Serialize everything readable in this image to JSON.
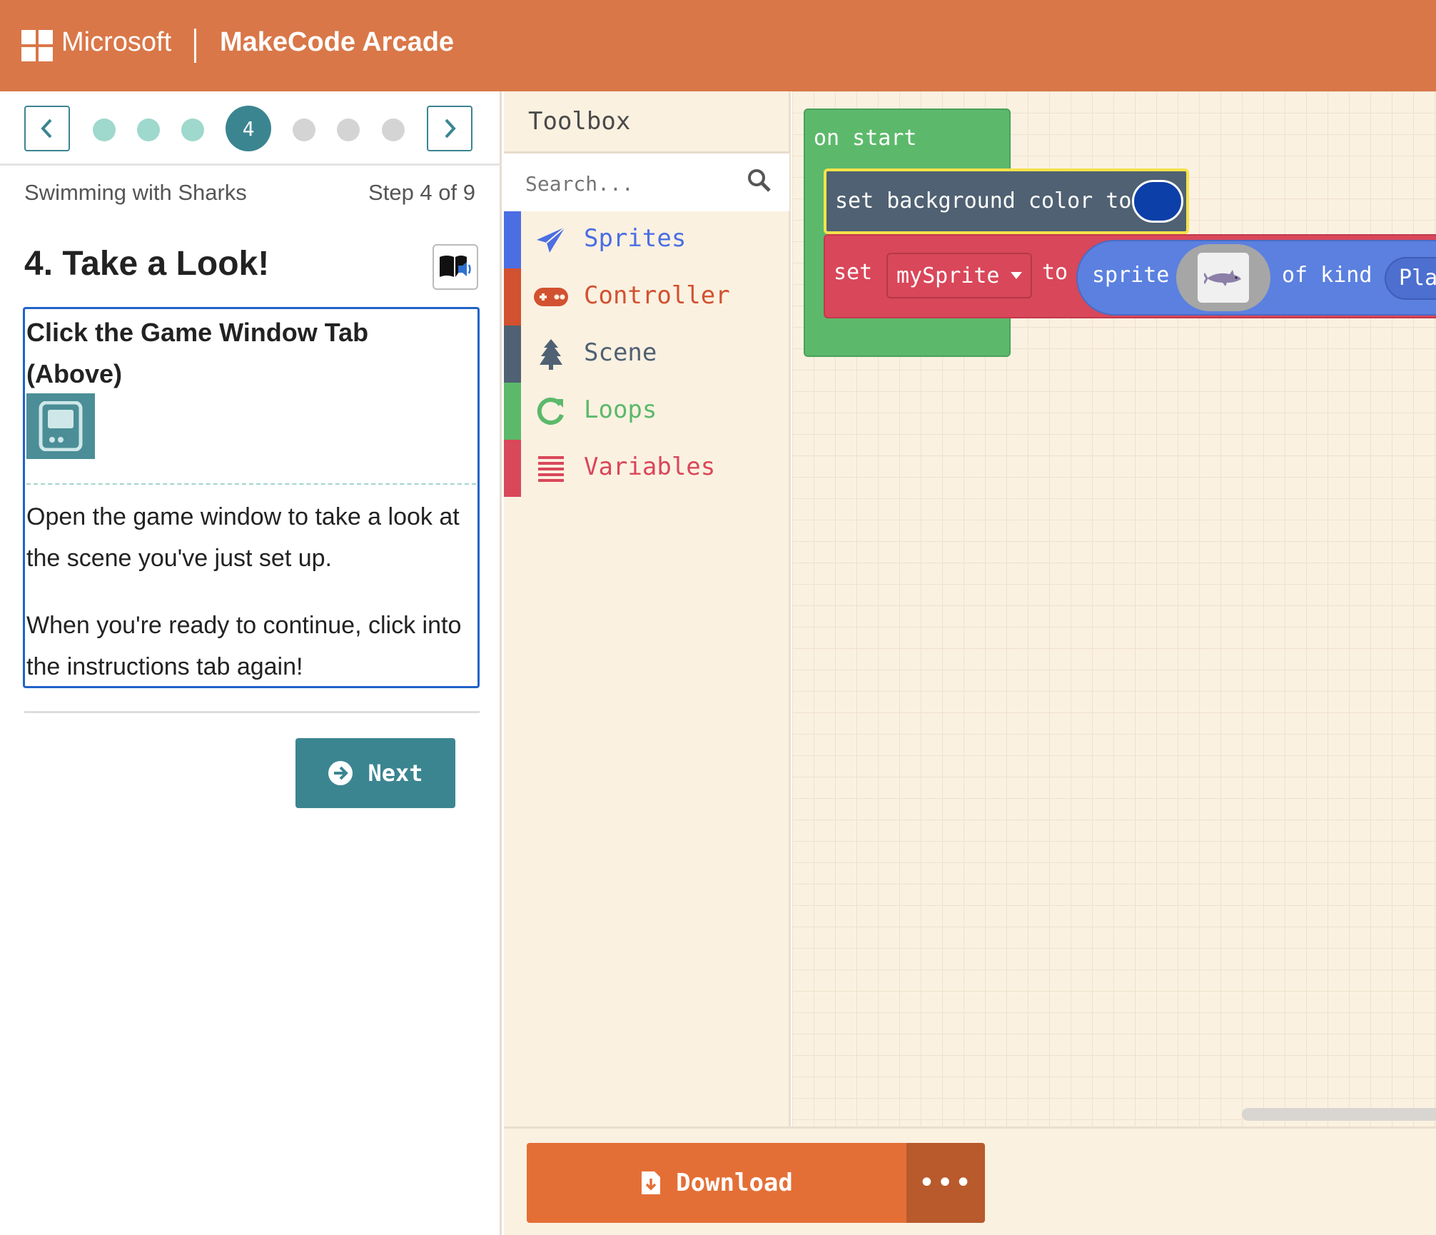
{
  "header": {
    "brand": "Microsoft",
    "app_title": "MakeCode Arcade",
    "bg_color": "#d97748"
  },
  "tutorial": {
    "current_step_number": "4",
    "steps_total": 9,
    "current_step": 4,
    "name": "Swimming with Sharks",
    "step_label": "Step 4 of 9",
    "title": "4. Take a Look!",
    "instruction_heading": "Click the Game Window Tab (Above)",
    "paragraph1": "Open the game window to take a look at the scene you've just set up.",
    "paragraph2": "When you're ready to continue, click into the instructions tab again!",
    "next_label": "Next",
    "accent_color": "#3b8591"
  },
  "toolbox": {
    "title": "Toolbox",
    "search_placeholder": "Search...",
    "categories": [
      {
        "label": "Sprites",
        "icon": "paper-plane-icon",
        "color": "#4b6ee3"
      },
      {
        "label": "Controller",
        "icon": "gamepad-icon",
        "color": "#d25130"
      },
      {
        "label": "Scene",
        "icon": "tree-icon",
        "color": "#4f6172"
      },
      {
        "label": "Loops",
        "icon": "refresh-icon",
        "color": "#5cb96b"
      },
      {
        "label": "Variables",
        "icon": "list-icon",
        "color": "#d9475a"
      }
    ]
  },
  "workspace": {
    "on_start": "on start",
    "set_bg": "set background color to",
    "set_word": "set",
    "variable": "mySprite",
    "to_word": "to",
    "sprite_word": "sprite",
    "of_kind": "of kind",
    "kind_value": "Play"
  },
  "bottombar": {
    "download_label": "Download",
    "more_label": "•••"
  }
}
